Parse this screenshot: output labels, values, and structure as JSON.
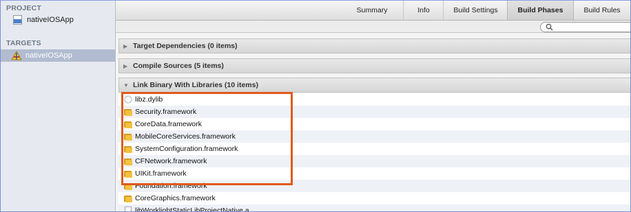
{
  "sidebar": {
    "project_header": "PROJECT",
    "project_name": "nativeIOSApp",
    "targets_header": "TARGETS",
    "target_name": "nativeIOSApp"
  },
  "toolbar": {
    "tabs": [
      {
        "label": "Summary"
      },
      {
        "label": "Info"
      },
      {
        "label": "Build Settings"
      },
      {
        "label": "Build Phases"
      },
      {
        "label": "Build Rules"
      }
    ],
    "active_tab": "Build Phases"
  },
  "search": {
    "icon": "search-icon",
    "value": ""
  },
  "phases": [
    {
      "title": "Target Dependencies (0 items)",
      "expanded": false
    },
    {
      "title": "Compile Sources (5 items)",
      "expanded": false
    },
    {
      "title": "Link Binary With Libraries (10 items)",
      "expanded": true
    }
  ],
  "libraries": [
    {
      "name": "libz.dylib",
      "icon": "dylib-icon"
    },
    {
      "name": "Security.framework",
      "icon": "framework-folder-icon"
    },
    {
      "name": "CoreData.framework",
      "icon": "framework-folder-icon"
    },
    {
      "name": "MobileCoreServices.framework",
      "icon": "framework-folder-icon"
    },
    {
      "name": "SystemConfiguration.framework",
      "icon": "framework-folder-icon"
    },
    {
      "name": "CFNetwork.framework",
      "icon": "framework-folder-icon"
    },
    {
      "name": "UIKit.framework",
      "icon": "framework-folder-icon"
    },
    {
      "name": "Foundation.framework",
      "icon": "framework-folder-icon"
    },
    {
      "name": "CoreGraphics.framework",
      "icon": "framework-folder-icon"
    },
    {
      "name": "libWorklightStaticLibProjectNative.a",
      "icon": "static-lib-file-icon"
    }
  ],
  "colors": {
    "highlight_border": "#e05a1a",
    "selected_row": "#b2bcd0",
    "sidebar_bg": "#e6eaf0"
  }
}
